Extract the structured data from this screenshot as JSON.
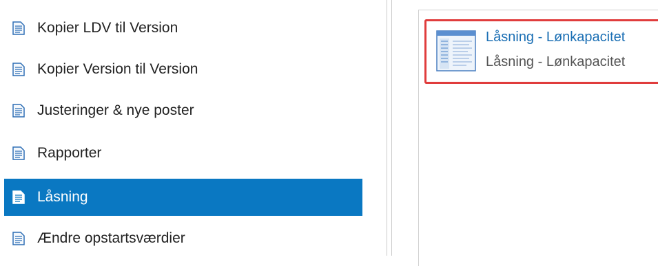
{
  "nav": {
    "items": [
      {
        "label": "Kopier LDV til Version",
        "selected": false
      },
      {
        "label": "Kopier Version til Version",
        "selected": false
      },
      {
        "label": "Justeringer & nye poster",
        "selected": false
      },
      {
        "label": "Rapporter",
        "selected": false
      },
      {
        "label": "Låsning",
        "selected": true
      },
      {
        "label": "Ændre opstartsværdier",
        "selected": false
      }
    ],
    "icon": "document-icon"
  },
  "tile": {
    "title": "Låsning - Lønkapacitet",
    "subtitle": "Låsning - Lønkapacitet",
    "icon": "report-window-icon"
  },
  "colors": {
    "selected_bg": "#0a78c2",
    "link_text": "#1b6fb4",
    "highlight_border": "#e03c3c"
  }
}
